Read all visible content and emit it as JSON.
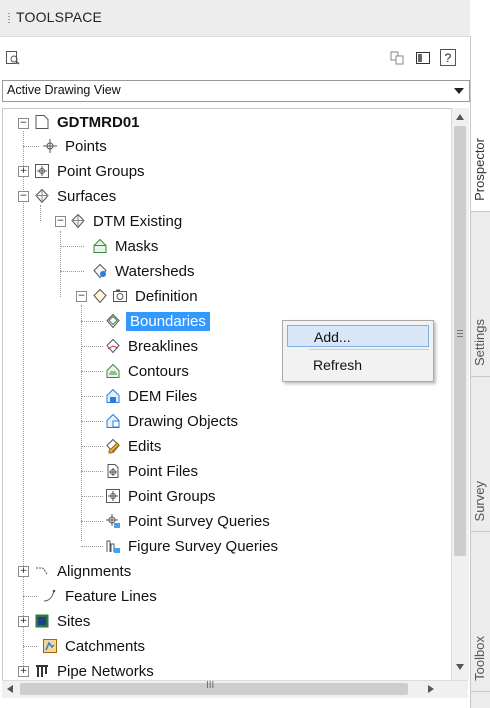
{
  "panel": {
    "title": "TOOLSPACE"
  },
  "toolbar": {
    "left_icon": "search-drawing-icon",
    "right_icons": [
      "copy-icon",
      "panel-icon",
      "help-icon"
    ],
    "help_glyph": "?"
  },
  "view_selector": {
    "value": "Active Drawing View"
  },
  "tree": {
    "root": "GDTMRD01",
    "items": {
      "points": "Points",
      "point_groups": "Point Groups",
      "surfaces": "Surfaces",
      "dtm_existing": "DTM Existing",
      "masks": "Masks",
      "watersheds": "Watersheds",
      "definition": "Definition",
      "boundaries": "Boundaries",
      "breaklines": "Breaklines",
      "contours": "Contours",
      "dem_files": "DEM Files",
      "drawing_objects": "Drawing Objects",
      "edits": "Edits",
      "point_files": "Point Files",
      "def_point_groups": "Point Groups",
      "point_survey_queries": "Point Survey Queries",
      "figure_survey_queries": "Figure Survey Queries",
      "alignments": "Alignments",
      "feature_lines": "Feature Lines",
      "sites": "Sites",
      "catchments": "Catchments",
      "pipe_networks": "Pipe Networks"
    },
    "selected": "Boundaries"
  },
  "context_menu": {
    "add": "Add...",
    "refresh": "Refresh"
  },
  "side_tabs": {
    "prospector": "Prospector",
    "settings": "Settings",
    "survey": "Survey",
    "toolbox": "Toolbox"
  },
  "scrollbar": {
    "grip": "III"
  },
  "colors": {
    "selection": "#3399ff",
    "menu_highlight": "#d8e6f7"
  }
}
